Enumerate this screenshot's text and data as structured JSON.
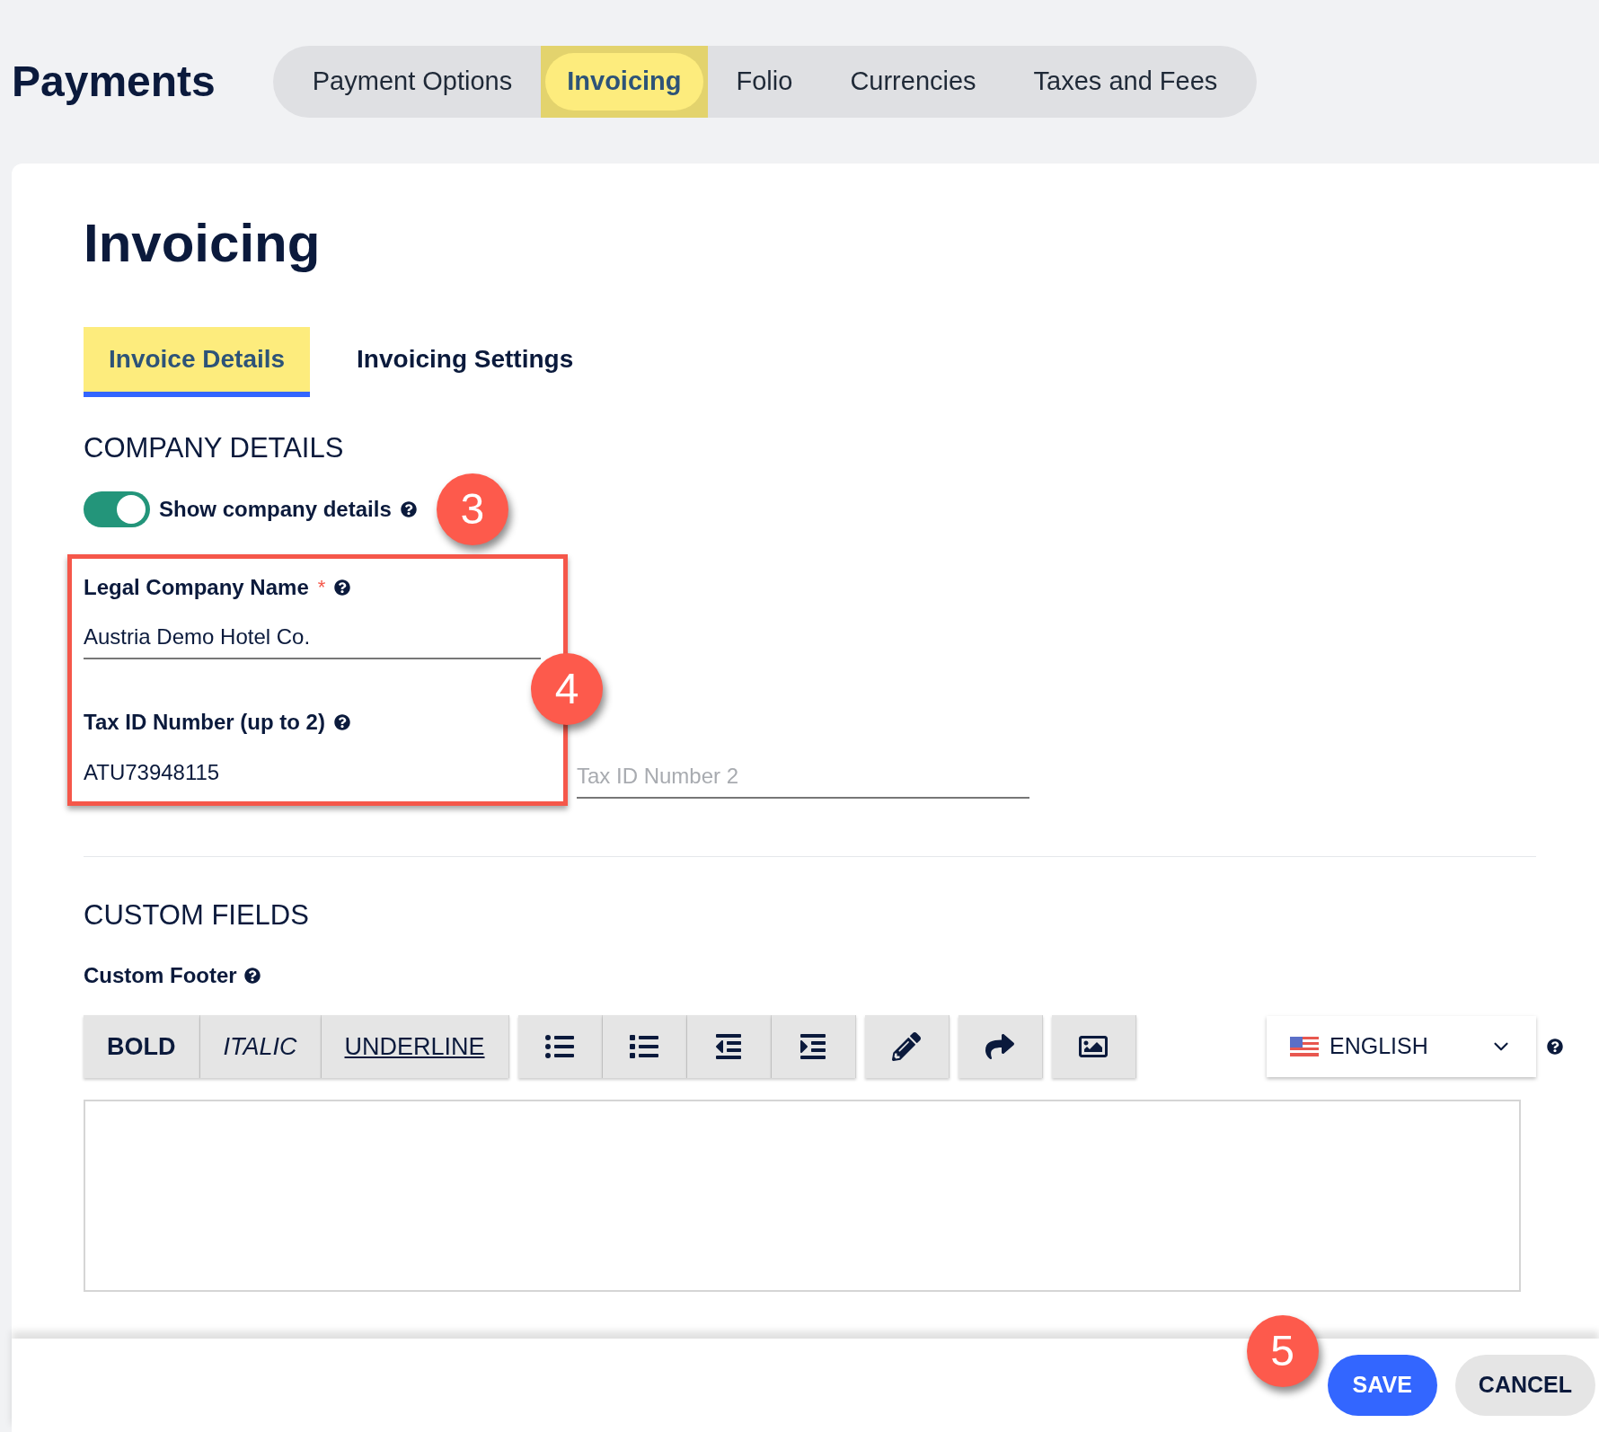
{
  "page_title": "Payments",
  "top_tabs": [
    {
      "label": "Payment Options",
      "selected": false
    },
    {
      "label": "Invoicing",
      "selected": true
    },
    {
      "label": "Folio",
      "selected": false
    },
    {
      "label": "Currencies",
      "selected": false
    },
    {
      "label": "Taxes and Fees",
      "selected": false
    }
  ],
  "heading": "Invoicing",
  "sub_tabs": [
    {
      "label": "Invoice Details",
      "selected": true
    },
    {
      "label": "Invoicing Settings",
      "selected": false
    }
  ],
  "company_details": {
    "title": "COMPANY DETAILS",
    "toggle": {
      "label": "Show company details",
      "on": true
    },
    "legal_name": {
      "label": "Legal Company Name",
      "required": "*",
      "value": "Austria Demo Hotel Co."
    },
    "tax_id": {
      "label": "Tax ID Number (up to 2)",
      "value": "ATU73948115",
      "placeholder": "Tax ID Number 2"
    }
  },
  "custom_fields": {
    "title": "CUSTOM FIELDS",
    "footer_label": "Custom Footer",
    "format_buttons": [
      {
        "label": "BOLD",
        "kind": "bold"
      },
      {
        "label": "ITALIC",
        "kind": "italic"
      },
      {
        "label": "UNDERLINE",
        "kind": "underline"
      }
    ],
    "language": "ENGLISH"
  },
  "annotations": [
    {
      "label": "3"
    },
    {
      "label": "4"
    },
    {
      "label": "5"
    }
  ],
  "buttons": {
    "save": "SAVE",
    "cancel": "CANCEL"
  }
}
